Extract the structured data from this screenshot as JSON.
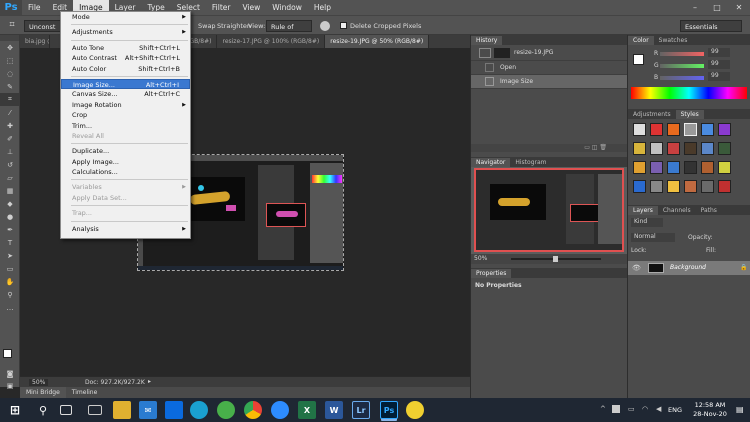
{
  "app": {
    "logo": "Ps"
  },
  "menubar": {
    "items": [
      "File",
      "Edit",
      "Image",
      "Layer",
      "Type",
      "Select",
      "Filter",
      "View",
      "Window",
      "Help"
    ],
    "active": "Image"
  },
  "window_controls": {
    "minimize": "–",
    "maximize": "□",
    "close": "✕"
  },
  "options": {
    "style_value": "Unconst",
    "swap_label": "Swap",
    "straighten_label": "Straighten",
    "view_label": "View:",
    "view_value": "Rule of Thirds",
    "delete_cropped_label": "Delete Cropped Pixels",
    "workspace": "Essentials"
  },
  "tabs": [
    {
      "label": "bia.jpg @ 6",
      "active": false
    },
    {
      "label": "(RGB/8#)",
      "active": false
    },
    {
      "label": "resize-17.JPG @ 100% (RGB/8#)",
      "active": false
    },
    {
      "label": "resize-19.JPG @ 50% (RGB/8#)",
      "active": true
    }
  ],
  "image_menu": [
    {
      "label": "Mode",
      "submenu": true
    },
    {
      "sep": true
    },
    {
      "label": "Adjustments",
      "submenu": true
    },
    {
      "sep": true
    },
    {
      "label": "Auto Tone",
      "shortcut": "Shift+Ctrl+L"
    },
    {
      "label": "Auto Contrast",
      "shortcut": "Alt+Shift+Ctrl+L"
    },
    {
      "label": "Auto Color",
      "shortcut": "Shift+Ctrl+B"
    },
    {
      "sep": true
    },
    {
      "label": "Image Size...",
      "shortcut": "Alt+Ctrl+I",
      "highlight": true
    },
    {
      "label": "Canvas Size...",
      "shortcut": "Alt+Ctrl+C"
    },
    {
      "label": "Image Rotation",
      "submenu": true
    },
    {
      "label": "Crop"
    },
    {
      "label": "Trim..."
    },
    {
      "label": "Reveal All",
      "disabled": true
    },
    {
      "sep": true
    },
    {
      "label": "Duplicate..."
    },
    {
      "label": "Apply Image..."
    },
    {
      "label": "Calculations..."
    },
    {
      "sep": true
    },
    {
      "label": "Variables",
      "submenu": true,
      "disabled": true
    },
    {
      "label": "Apply Data Set...",
      "disabled": true
    },
    {
      "sep": true
    },
    {
      "label": "Trap...",
      "disabled": true
    },
    {
      "sep": true
    },
    {
      "label": "Analysis",
      "submenu": true
    }
  ],
  "status": {
    "zoom": "50%",
    "doc": "Doc: 927.2K/927.2K"
  },
  "bottom_tabs": [
    "Mini Bridge",
    "Timeline"
  ],
  "history": {
    "tab": "History",
    "snapshot": "resize-19.JPG",
    "states": [
      "Open",
      "Image Size"
    ]
  },
  "navigator": {
    "tabs": [
      "Navigator",
      "Histogram"
    ],
    "zoom": "50%"
  },
  "properties": {
    "tab": "Properties",
    "empty": "No Properties"
  },
  "color": {
    "tabs": [
      "Color",
      "Swatches"
    ],
    "channels": [
      {
        "name": "R",
        "value": "99"
      },
      {
        "name": "G",
        "value": "99"
      },
      {
        "name": "B",
        "value": "99"
      }
    ]
  },
  "adjustments": {
    "tabs": [
      "Adjustments",
      "Styles"
    ]
  },
  "layers": {
    "tabs": [
      "Layers",
      "Channels",
      "Paths"
    ],
    "kind": "Kind",
    "blend": "Normal",
    "opacity_label": "Opacity:",
    "lock_label": "Lock:",
    "fill_label": "Fill:",
    "layer_name": "Background"
  },
  "taskbar": {
    "time": "12:58 AM",
    "date": "28-Nov-20",
    "lang": "ENG",
    "apps": [
      "Word",
      "Excel",
      "Lr",
      "Ps"
    ]
  }
}
